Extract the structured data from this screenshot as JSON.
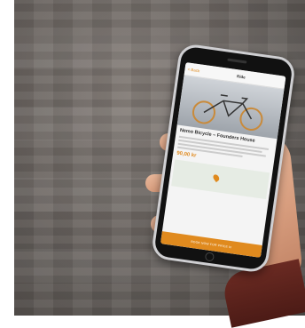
{
  "app": {
    "nav_back": "< Back",
    "nav_title": "Ride",
    "listing_title": "Nemo Bicycle – Founders House",
    "price": "90,00 kr",
    "book_button": "BOOK NOW FOR PRICE kr"
  },
  "colors": {
    "accent": "#e08a1e",
    "phone_frame": "#cfcfd2",
    "background_brick": "#6c6662"
  },
  "icons": [
    "bicycle-image",
    "map-pin-icon",
    "home-button"
  ]
}
